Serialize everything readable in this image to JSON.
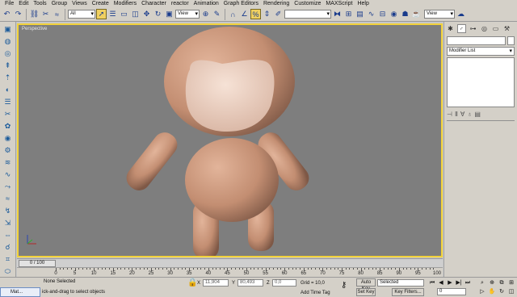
{
  "menu": [
    "File",
    "Edit",
    "Tools",
    "Group",
    "Views",
    "Create",
    "Modifiers",
    "Character",
    "reactor",
    "Animation",
    "Graph Editors",
    "Rendering",
    "Customize",
    "MAXScript",
    "Help"
  ],
  "toolbar": {
    "filter_value": "All",
    "refcoord_value": "View",
    "named_sel_value": "",
    "right_select_value": "View"
  },
  "viewport": {
    "label": "Perspective",
    "axis_label": "x y z",
    "colors": {
      "bg": "#7e7e7e",
      "border": "#f2d23a",
      "figure": "#c9967a",
      "face": "#f0d6c8"
    }
  },
  "command_panel": {
    "modifier_list_label": "Modifier List"
  },
  "timeline": {
    "slider_label": "0 / 100",
    "ticks": [
      "0",
      "5",
      "10",
      "15",
      "20",
      "25",
      "30",
      "35",
      "40",
      "45",
      "50",
      "55",
      "60",
      "65",
      "70",
      "75",
      "80",
      "85",
      "90",
      "95",
      "100"
    ]
  },
  "status": {
    "mini_label": "Mat...",
    "selection": "None Selected",
    "prompt": "ick-and-drag to select objects",
    "x_label": "X",
    "x_value": "11,904",
    "y_label": "Y",
    "y_value": "80,493",
    "z_label": "Z",
    "z_value": "0,0",
    "grid": "Grid = 10,0",
    "add_time_tag": "Add Time Tag",
    "auto_key": "Auto Key",
    "set_key": "Set Key",
    "selected_dropdown": "Selected",
    "key_filters": "Key Filters...",
    "frame_value": "0"
  }
}
